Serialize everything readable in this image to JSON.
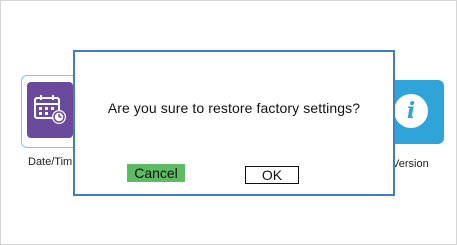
{
  "background": {
    "tiles": [
      {
        "label": "Date/Tim",
        "icon": "calendar-clock-icon",
        "color": "#6a4a9c"
      },
      {
        "label": "Version",
        "icon": "info-icon",
        "color": "#2ea4d8",
        "glyph": "i"
      }
    ]
  },
  "dialog": {
    "message": "Are you sure to restore factory settings?",
    "cancel_label": "Cancel",
    "ok_label": "OK",
    "cancel_color": "#5dbb63",
    "border_color": "#3f7fc1"
  }
}
